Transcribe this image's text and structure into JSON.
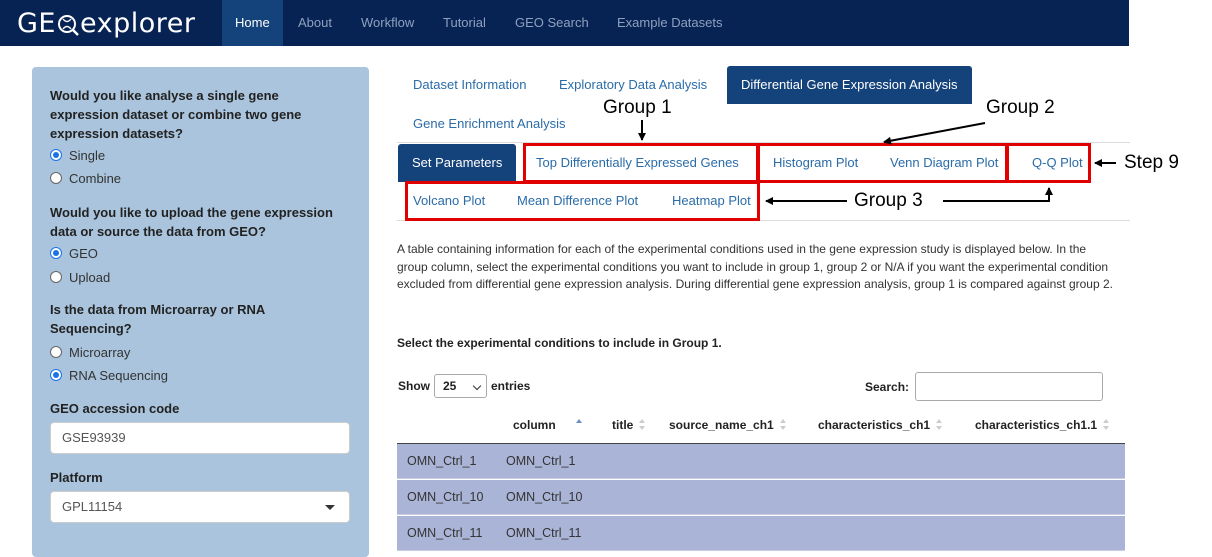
{
  "navbar": {
    "brand": "GEOexplorer",
    "brand_left": "GE",
    "brand_right": "explorer",
    "items": [
      "Home",
      "About",
      "Workflow",
      "Tutorial",
      "GEO Search",
      "Example Datasets"
    ]
  },
  "sidebar": {
    "q1": "Would you like analyse a single gene expression dataset or combine two gene expression datasets?",
    "q1_options": [
      "Single",
      "Combine"
    ],
    "q2": "Would you like to upload the gene expression data or source the data from GEO?",
    "q2_options": [
      "GEO",
      "Upload"
    ],
    "q3": "Is the data from Microarray or RNA Sequencing?",
    "q3_options": [
      "Microarray",
      "RNA Sequencing"
    ],
    "accession_label": "GEO accession code",
    "accession_value": "GSE93939",
    "platform_label": "Platform",
    "platform_value": "GPL11154"
  },
  "tabs": {
    "main": [
      "Dataset Information",
      "Exploratory Data Analysis",
      "Differential Gene Expression Analysis",
      "Gene Enrichment Analysis"
    ],
    "sub": [
      "Set Parameters",
      "Top Differentially Expressed Genes",
      "Histogram Plot",
      "Venn Diagram Plot",
      "Q-Q Plot",
      "Volcano Plot",
      "Mean Difference Plot",
      "Heatmap Plot"
    ]
  },
  "annotations": {
    "group1": "Group 1",
    "group2": "Group 2",
    "group3": "Group 3",
    "step9": "Step 9"
  },
  "content": {
    "paragraph": "A table containing information for each of the experimental conditions used in the gene expression study is displayed below. In the group column, select the experimental conditions you want to include in group 1, group 2 or N/A if you want the experimental condition excluded from differential gene expression analysis. During differential gene expression analysis, group 1 is compared against group 2.",
    "instruction": "Select the experimental conditions to include in Group 1.",
    "show_label": "Show",
    "entries_value": "25",
    "entries_label": "entries",
    "search_label": "Search:"
  },
  "table": {
    "headers": [
      "column",
      "title",
      "source_name_ch1",
      "characteristics_ch1",
      "characteristics_ch1.1"
    ],
    "rows": [
      [
        "OMN_Ctrl_1",
        "OMN_Ctrl_1"
      ],
      [
        "OMN_Ctrl_10",
        "OMN_Ctrl_10"
      ],
      [
        "OMN_Ctrl_11",
        "OMN_Ctrl_11"
      ]
    ]
  },
  "colors": {
    "navbar": "#072353",
    "active_tab": "#14427a",
    "sidebar": "#a9c4dc",
    "highlight": "#e00000",
    "row": "#aab4d6"
  }
}
